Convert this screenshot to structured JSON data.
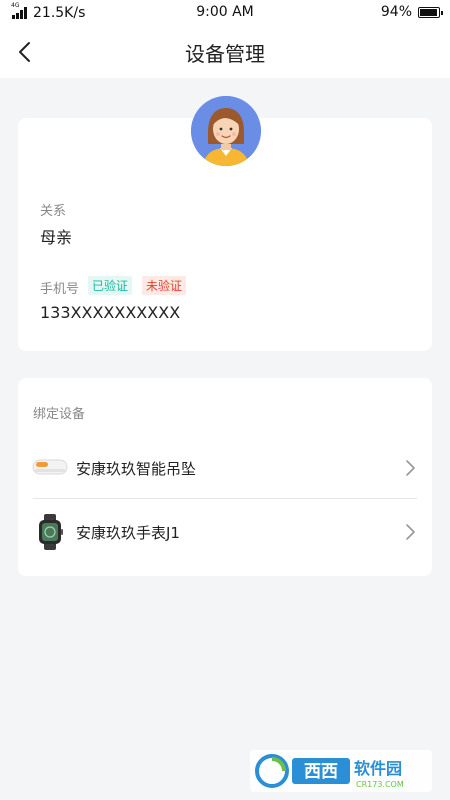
{
  "status_bar": {
    "network_type": "4G",
    "network_speed": "21.5K/s",
    "time": "9:00 AM",
    "battery": "94%",
    "battery_level": 0.94
  },
  "nav": {
    "title": "设备管理",
    "back_icon": "chevron-left-icon"
  },
  "profile": {
    "relation_label": "关系",
    "relation_value": "母亲",
    "phone_label": "手机号",
    "verified_badge": "已验证",
    "unverified_badge": "未验证",
    "phone_value": "133XXXXXXXXXX"
  },
  "devices": {
    "section_title": "绑定设备",
    "items": [
      {
        "name": "安康玖玖智能吊坠",
        "icon": "pendant-device-icon"
      },
      {
        "name": "安康玖玖手表J1",
        "icon": "smartwatch-icon"
      }
    ]
  },
  "watermark": {
    "text": "西西软件园",
    "subtext": "CR173.COM"
  },
  "colors": {
    "background": "#f4f5f7",
    "verified": "#1db9a0",
    "unverified": "#e0462e",
    "avatar_bg": "#6a8ee6"
  }
}
